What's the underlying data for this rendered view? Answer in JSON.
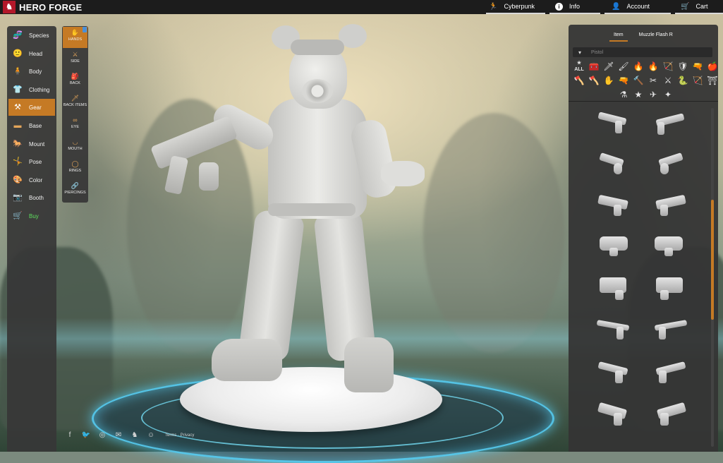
{
  "app": {
    "logo_mark": "♞",
    "logo_text": "HERO FORGE"
  },
  "topnav": [
    {
      "icon": "🏃",
      "label": "Cyberpunk"
    },
    {
      "icon": "i",
      "label": "Info"
    },
    {
      "icon": "👤",
      "label": "Account"
    },
    {
      "icon": "🛒",
      "label": "Cart"
    }
  ],
  "categories": [
    {
      "icon": "🧬",
      "label": "Species"
    },
    {
      "icon": "🙂",
      "label": "Head"
    },
    {
      "icon": "🧍",
      "label": "Body"
    },
    {
      "icon": "👕",
      "label": "Clothing"
    },
    {
      "icon": "⚒",
      "label": "Gear",
      "active": true
    },
    {
      "icon": "▬",
      "label": "Base"
    },
    {
      "icon": "🐎",
      "label": "Mount"
    },
    {
      "icon": "🤸",
      "label": "Pose"
    },
    {
      "icon": "🎨",
      "label": "Color"
    },
    {
      "icon": "📷",
      "label": "Booth"
    },
    {
      "icon": "🛒",
      "label": "Buy"
    }
  ],
  "subcategories": [
    {
      "icon": "✋",
      "label": "HANDS"
    },
    {
      "icon": "⚔",
      "label": "SIDE"
    },
    {
      "icon": "🎒",
      "label": "BACK"
    },
    {
      "icon": "🗡",
      "label": "BACK ITEMS"
    },
    {
      "icon": "∞",
      "label": "EYE"
    },
    {
      "icon": "◡",
      "label": "MOUTH"
    },
    {
      "icon": "◯",
      "label": "RINGS"
    },
    {
      "icon": "🔗",
      "label": "PIERCINGS"
    }
  ],
  "right_panel": {
    "tabs": [
      "Item",
      "Muzzle Flash R"
    ],
    "search_placeholder": "Pistol",
    "filter_icons": [
      "★ ALL",
      "🧰",
      "🗡",
      "🖌",
      "🔥",
      "🔥",
      "🏹",
      "🛡",
      "🔫",
      "🍎",
      "🪓",
      "🪓",
      "✋",
      "🔫",
      "🔨",
      "✂",
      "⚔",
      "🐍",
      "🏹",
      "⛩",
      "⚗",
      "★",
      "✈",
      "✦"
    ]
  },
  "footer": {
    "icons": [
      "f",
      "🐦",
      "◎",
      "✉",
      "♞",
      "☺"
    ],
    "links": "Terms · Privacy"
  }
}
